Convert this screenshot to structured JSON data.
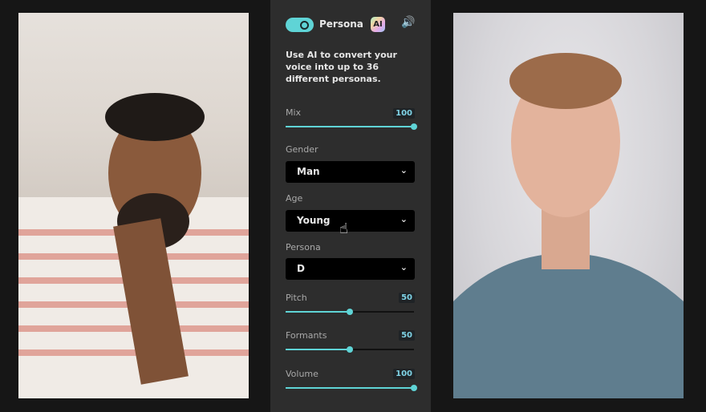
{
  "photos": {
    "left": {
      "description": "man with beard and glasses in striped shirt"
    },
    "right": {
      "description": "young man in blue t-shirt"
    }
  },
  "panel": {
    "toggle": {
      "on": true
    },
    "title": "Persona",
    "ai_badge": "AI",
    "speaker_icon": "🔊",
    "description": "Use AI to convert your voice into up to 36 different personas.",
    "mix": {
      "label": "Mix",
      "value": "100",
      "fraction": 1.0
    },
    "gender": {
      "label": "Gender",
      "selected": "Man"
    },
    "age": {
      "label": "Age",
      "selected": "Young"
    },
    "persona": {
      "label": "Persona",
      "selected": "D"
    },
    "pitch": {
      "label": "Pitch",
      "value": "50",
      "fraction": 0.5
    },
    "formants": {
      "label": "Formants",
      "value": "50",
      "fraction": 0.5
    },
    "volume": {
      "label": "Volume",
      "value": "100",
      "fraction": 1.0
    },
    "chevron": "⌄",
    "cursor": "☝"
  }
}
